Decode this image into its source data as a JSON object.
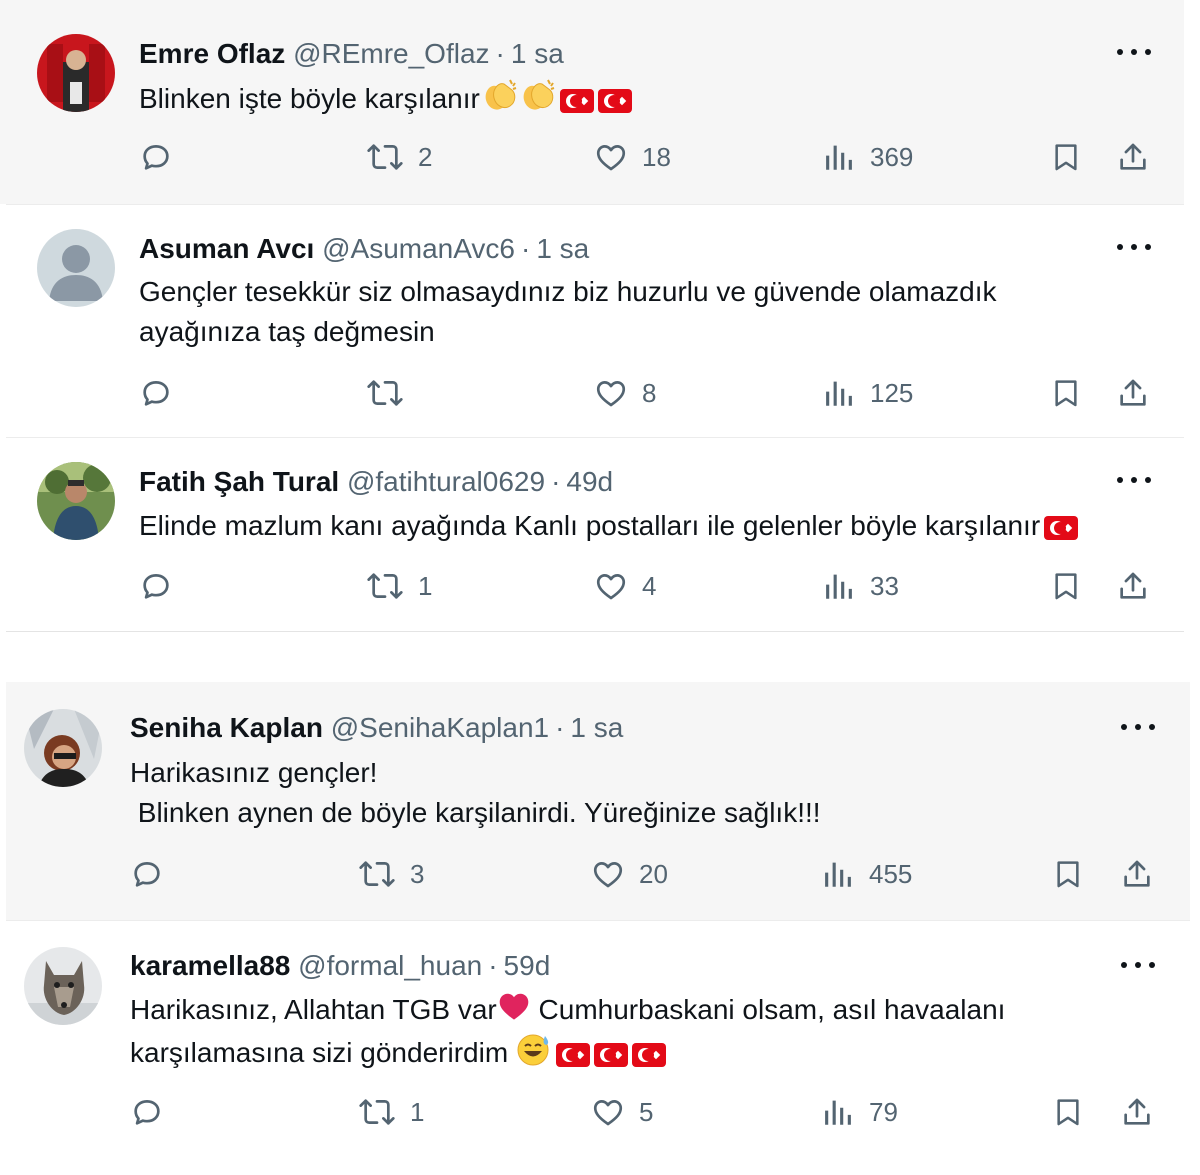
{
  "tweets": [
    {
      "name": "Emre Oflaz",
      "handle": "@REmre_Oflaz",
      "time": "1 sa",
      "lines": [
        "Blinken işte böyle karşılanır"
      ],
      "line_emojis": [
        [
          "clapping-hands",
          "clapping-hands",
          "turkey-flag",
          "turkey-flag"
        ]
      ],
      "avatar": "avatar-emre",
      "stats": {
        "reply": "",
        "retweet": "2",
        "like": "18",
        "views": "369"
      }
    },
    {
      "name": "Asuman Avcı",
      "handle": "@AsumanAvc6",
      "time": "1 sa",
      "lines": [
        "Gençler tesekkür siz olmasaydınız biz huzurlu ve güvende olamazdık",
        "ayağınıza taş değmesin"
      ],
      "line_emojis": [
        [],
        []
      ],
      "avatar": "avatar-default",
      "stats": {
        "reply": "",
        "retweet": "",
        "like": "8",
        "views": "125"
      }
    },
    {
      "name": "Fatih Şah Tural",
      "handle": "@fatihtural0629",
      "time": "49d",
      "lines": [
        "Elinde mazlum kanı ayağında Kanlı postalları ile gelenler böyle karşılanır"
      ],
      "line_emojis": [
        [
          "turkey-flag"
        ]
      ],
      "avatar": "avatar-fatih",
      "stats": {
        "reply": "",
        "retweet": "1",
        "like": "4",
        "views": "33"
      }
    },
    {
      "name": "Seniha Kaplan",
      "handle": "@SenihaKaplan1",
      "time": "1 sa",
      "lines": [
        "Harikasınız gençler!",
        " Blinken aynen de böyle karşilanirdi. Yüreğinize sağlık!!!"
      ],
      "line_emojis": [
        [],
        []
      ],
      "avatar": "avatar-seniha",
      "stats": {
        "reply": "",
        "retweet": "3",
        "like": "20",
        "views": "455"
      }
    },
    {
      "name": "karamella88",
      "handle": "@formal_huan",
      "time": "59d",
      "lines": [
        "Harikasınız, Allahtan TGB var",
        " Cumhurbaskani olsam, asıl havaalanı",
        "karşılamasına sizi gönderirdim "
      ],
      "line_emojis": [
        [
          "red-heart"
        ],
        [],
        [
          "sweat-smile",
          "turkey-flag",
          "turkey-flag",
          "turkey-flag"
        ]
      ],
      "avatar": "avatar-wolf",
      "stats": {
        "reply": "",
        "retweet": "1",
        "like": "5",
        "views": "79"
      }
    }
  ],
  "icons": {
    "reply": "reply-icon",
    "retweet": "retweet-icon",
    "like": "like-icon",
    "views": "views-icon",
    "bookmark": "bookmark-icon",
    "share": "share-icon",
    "more": "more-icon"
  },
  "colors": {
    "text": "#0f1419",
    "muted": "#536471",
    "flag": "#e30a17",
    "heart": "#e0245e"
  }
}
